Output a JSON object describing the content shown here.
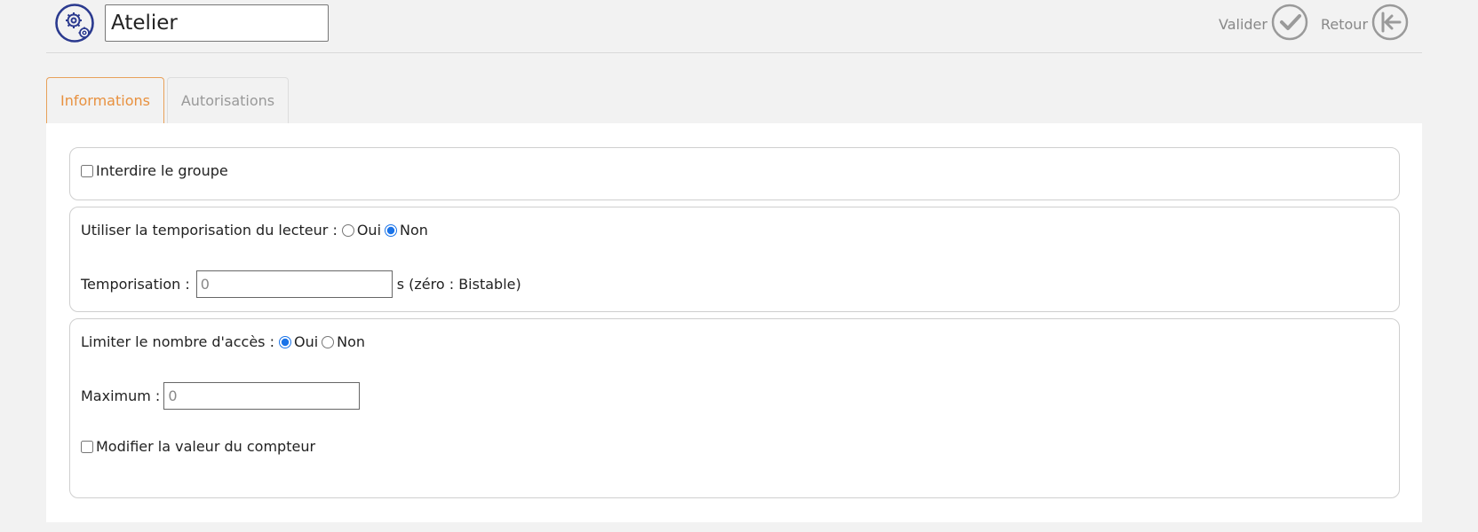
{
  "header": {
    "record_name": "Atelier",
    "logo_icon": "gears-icon",
    "valider_label": "Valider",
    "retour_label": "Retour",
    "colors": {
      "logo": "#2b3a8f",
      "action": "#999999",
      "active_tab": "#e8913f"
    }
  },
  "tabs": [
    {
      "label": "Informations",
      "active": true
    },
    {
      "label": "Autorisations",
      "active": false
    }
  ],
  "form": {
    "forbid_group": {
      "label": "Interdire le groupe",
      "checked": false
    },
    "use_reader_timer": {
      "label": "Utiliser la temporisation du lecteur :",
      "yes": "Oui",
      "no": "Non",
      "value": "Non"
    },
    "timer": {
      "label": "Temporisation :",
      "value": "0",
      "suffix": "s (zéro : Bistable)"
    },
    "limit_access": {
      "label": "Limiter le nombre d'accès :",
      "yes": "Oui",
      "no": "Non",
      "value": "Oui"
    },
    "maximum": {
      "label": "Maximum :",
      "value": "0"
    },
    "modify_counter": {
      "label": "Modifier la valeur du compteur",
      "checked": false
    }
  }
}
